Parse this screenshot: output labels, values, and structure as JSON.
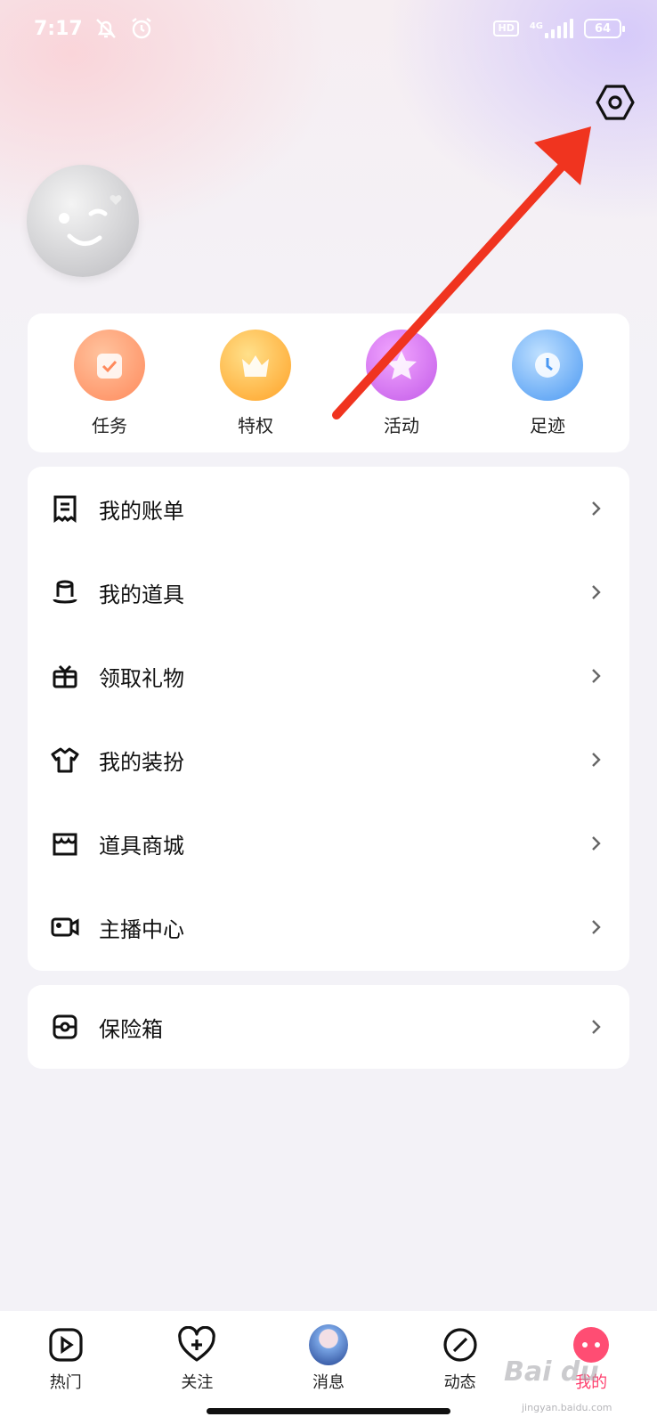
{
  "status_bar": {
    "time": "7:17",
    "hd": "HD",
    "network": "4G",
    "battery": "64"
  },
  "quick_actions": [
    {
      "label": "任务",
      "icon": "task-icon",
      "color": "#ff8a5c"
    },
    {
      "label": "特权",
      "icon": "crown-icon",
      "color": "#ffb03a"
    },
    {
      "label": "活动",
      "icon": "star-icon",
      "color": "#d46cf0"
    },
    {
      "label": "足迹",
      "icon": "clock-icon",
      "color": "#5aa6f5"
    }
  ],
  "menu": [
    {
      "label": "我的账单",
      "icon": "bill-icon"
    },
    {
      "label": "我的道具",
      "icon": "hat-icon"
    },
    {
      "label": "领取礼物",
      "icon": "gift-icon"
    },
    {
      "label": "我的装扮",
      "icon": "shirt-icon"
    },
    {
      "label": "道具商城",
      "icon": "store-icon"
    },
    {
      "label": "主播中心",
      "icon": "video-camera-icon"
    }
  ],
  "menu2": [
    {
      "label": "保险箱",
      "icon": "safe-icon"
    }
  ],
  "bottom_nav": [
    {
      "label": "热门",
      "icon": "play-icon"
    },
    {
      "label": "关注",
      "icon": "heart-plus-icon"
    },
    {
      "label": "消息",
      "icon": "message-avatar-icon"
    },
    {
      "label": "动态",
      "icon": "slash-circle-icon"
    },
    {
      "label": "我的",
      "icon": "profile-face-icon",
      "active": true
    }
  ],
  "watermark": {
    "text": "Bai du",
    "sub": "jingyan.baidu.com"
  },
  "colors": {
    "accent": "#ff3f6e",
    "arrow": "#f0341f"
  }
}
